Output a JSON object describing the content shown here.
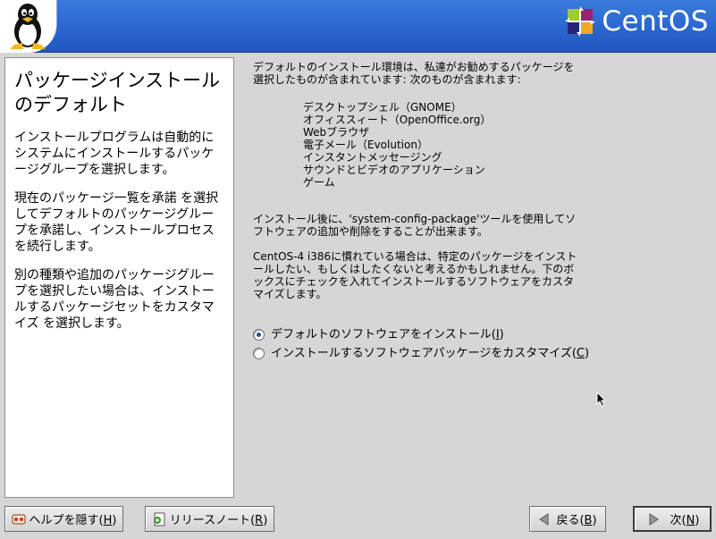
{
  "header": {
    "brand": "CentOS",
    "colors": {
      "banner": "#2a66cf",
      "brand_text": "#ffffff"
    },
    "icons": {
      "logo": "tux-penguin-icon",
      "brand_logo": "centos-logo-icon"
    }
  },
  "help": {
    "title": "パッケージインストールのデフォルト",
    "paragraphs": [
      "インストールプログラムは自動的にシステムにインストールするパッケージグループを選択します。",
      "現在のパッケージ一覧を承諾 を選択してデフォルトのパッケージグループを承諾し、インストールプロセスを続行します。",
      "別の種類や追加のパッケージグループを選択したい場合は、インストールするパッケージセットをカスタマイズ を選択します。"
    ]
  },
  "content": {
    "intro": "デフォルトのインストール環境は、私達がお勧めするパッケージを選択したものが含まれています: 次のものが含まれます:",
    "packages": [
      "デスクトップシェル（GNOME）",
      "オフィススィート（OpenOffice.org）",
      "Webブラウザ",
      "電子メール（Evolution）",
      "インスタントメッセージング",
      "サウンドとビデオのアプリケーション",
      "ゲーム"
    ],
    "para_after_install": "インストール後に、'system-config-package'ツールを使用してソフトウェアの追加や削除をすることが出来ます。",
    "para_customize": "CentOS-4 i386に慣れている場合は、特定のパッケージをインストールしたい、もしくはしたくないと考えるかもしれません。下のボックスにチェックを入れてインストールするソフトウェアをカスタマイズします。",
    "options": [
      {
        "label": "デフォルトのソフトウェアをインストール(",
        "key": "I",
        "suffix": ")",
        "checked": true
      },
      {
        "label": "インストールするソフトウェアパッケージをカスタマイズ(",
        "key": "C",
        "suffix": ")",
        "checked": false
      }
    ]
  },
  "buttons": {
    "help": {
      "label": "ヘルプを隠す(",
      "key": "H",
      "suffix": ")",
      "icon": "help-icon"
    },
    "release_notes": {
      "label": "リリースノート(",
      "key": "R",
      "suffix": ")",
      "icon": "release-notes-icon"
    },
    "back": {
      "label": "戻る(",
      "key": "B",
      "suffix": ")",
      "icon": "back-arrow-icon"
    },
    "next": {
      "label": "次(",
      "key": "N",
      "suffix": ")",
      "icon": "next-arrow-icon"
    }
  }
}
